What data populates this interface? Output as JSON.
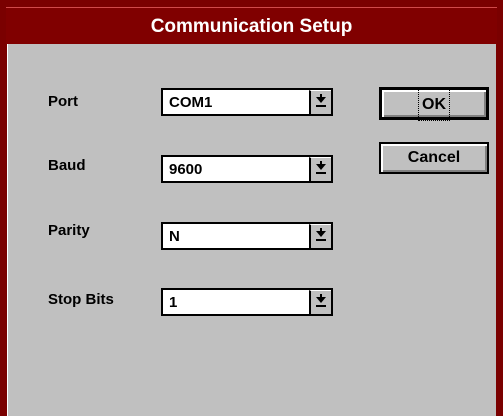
{
  "window": {
    "title": "Communication Setup"
  },
  "fields": [
    {
      "label": "Port",
      "value": "COM1"
    },
    {
      "label": "Baud",
      "value": "9600"
    },
    {
      "label": "Parity",
      "value": "N"
    },
    {
      "label": "Stop Bits",
      "value": "1"
    }
  ],
  "buttons": {
    "ok": "OK",
    "cancel": "Cancel"
  },
  "colors": {
    "title_bar": "#800000",
    "face": "#c0c0c0"
  }
}
